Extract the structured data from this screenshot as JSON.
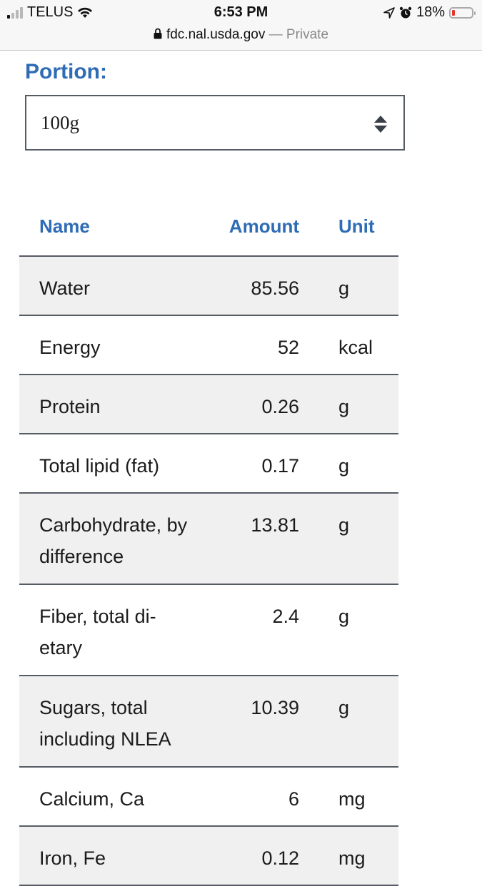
{
  "status_bar": {
    "carrier": "TELUS",
    "time": "6:53 PM",
    "battery_percent": "18%",
    "battery_level": 0.18,
    "signal_bars_active": 1,
    "signal_bars_total": 4,
    "icons": [
      "signal-icon",
      "wifi-icon",
      "location-icon",
      "alarm-icon",
      "battery-icon"
    ]
  },
  "browser": {
    "domain": "fdc.nal.usda.gov",
    "separator": " — ",
    "mode": "Private"
  },
  "portion": {
    "label": "Portion:",
    "selected": "100g"
  },
  "table": {
    "headers": {
      "name": "Name",
      "amount": "Amount",
      "unit": "Unit"
    },
    "rows": [
      {
        "name": "Water",
        "amount": "85.56",
        "unit": "g"
      },
      {
        "name": "Energy",
        "amount": "52",
        "unit": "kcal"
      },
      {
        "name": "Protein",
        "amount": "0.26",
        "unit": "g"
      },
      {
        "name": "Total lipid (fat)",
        "amount": "0.17",
        "unit": "g"
      },
      {
        "name": "Carbohydrate, by difference",
        "amount": "13.81",
        "unit": "g"
      },
      {
        "name": "Fiber, total di-etary",
        "amount": "2.4",
        "unit": "g"
      },
      {
        "name": "Sugars, total including NLEA",
        "amount": "10.39",
        "unit": "g"
      },
      {
        "name": "Calcium, Ca",
        "amount": "6",
        "unit": "mg"
      },
      {
        "name": "Iron, Fe",
        "amount": "0.12",
        "unit": "mg"
      }
    ]
  },
  "colors": {
    "accent": "#2e6cb5",
    "row_alt": "#f0f0f0",
    "border": "#565c65",
    "battery_low": "#e8332f"
  }
}
